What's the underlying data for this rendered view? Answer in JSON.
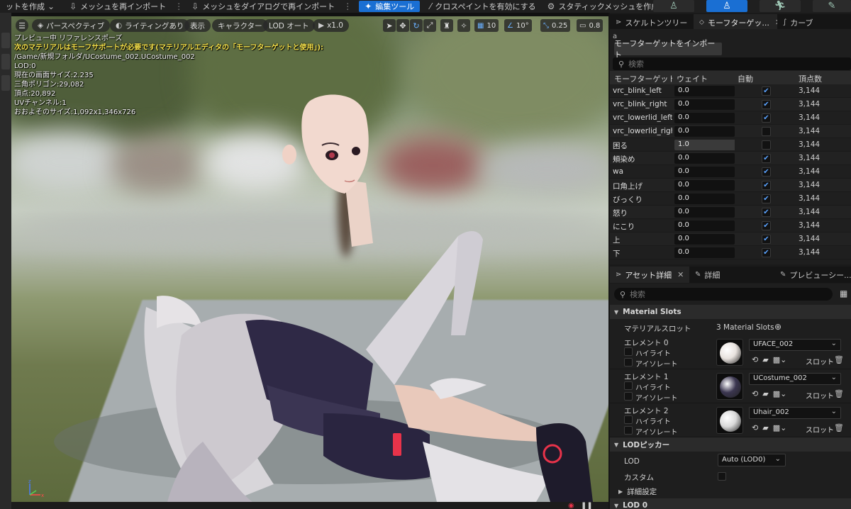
{
  "toolbar": {
    "create_label": "ットを作成",
    "reimport_label": "メッシュを再インポート",
    "reimport_dialog_label": "メッシュをダイアログで再インポート",
    "edit_tool_label": "編集ツール",
    "cloth_paint_label": "クロスペイントを有効にする",
    "static_mesh_label": "スタティックメッシュを作成"
  },
  "viewport": {
    "perspective_label": "パースペクティブ",
    "lighting_label": "ライティングあり",
    "show_label": "表示",
    "character_label": "キャラクター",
    "lod_label": "LOD オート",
    "play_label": "x1.0",
    "grid_value": "10",
    "angle_value": "10°",
    "scale_value": "0.25",
    "camera_speed_value": "0.8",
    "overlay": {
      "line1": "プレビュー中 リファレンスポーズ",
      "warning": "次のマテリアルはモーフサポートが必要です(マテリアルエディタの「モーフターゲットと使用」):",
      "path": "/Game/新規フォルダ/UCostume_002.UCostume_002",
      "lod": "LOD:0",
      "screen_size": "現在の画面サイズ:2.235",
      "triangles": "三角ポリゴン:29,082",
      "vertices": "頂点:20,892",
      "uv_channels": "UVチャンネル:1",
      "approx_size": "おおよそのサイズ:1,092x1,346x726"
    }
  },
  "panel_tabs": {
    "skeleton_tree": "スケルトンツリー",
    "morph_target": "モーフターゲッ...",
    "curve": "カーブ"
  },
  "morph": {
    "label_a": "a",
    "import_button": "モーフターゲットをインポート",
    "search_placeholder": "検索",
    "headers": {
      "name": "モーフターゲット名",
      "weight": "ウェイト",
      "auto": "自動",
      "vertex_count": "頂点数"
    },
    "rows": [
      {
        "name": "vrc_blink_left",
        "weight": "0.0",
        "auto": true,
        "vertices": "3,144"
      },
      {
        "name": "vrc_blink_right",
        "weight": "0.0",
        "auto": true,
        "vertices": "3,144"
      },
      {
        "name": "vrc_lowerlid_left",
        "weight": "0.0",
        "auto": true,
        "vertices": "3,144"
      },
      {
        "name": "vrc_lowerlid_right",
        "weight": "0.0",
        "auto": false,
        "vertices": "3,144"
      },
      {
        "name": "困る",
        "weight": "1.0",
        "auto": false,
        "vertices": "3,144"
      },
      {
        "name": "頬染め",
        "weight": "0.0",
        "auto": true,
        "vertices": "3,144"
      },
      {
        "name": "wa",
        "weight": "0.0",
        "auto": true,
        "vertices": "3,144"
      },
      {
        "name": "口角上げ",
        "weight": "0.0",
        "auto": true,
        "vertices": "3,144"
      },
      {
        "name": "びっくり",
        "weight": "0.0",
        "auto": true,
        "vertices": "3,144"
      },
      {
        "name": "怒り",
        "weight": "0.0",
        "auto": true,
        "vertices": "3,144"
      },
      {
        "name": "にこり",
        "weight": "0.0",
        "auto": true,
        "vertices": "3,144"
      },
      {
        "name": "上",
        "weight": "0.0",
        "auto": true,
        "vertices": "3,144"
      },
      {
        "name": "下",
        "weight": "0.0",
        "auto": true,
        "vertices": "3,144"
      }
    ]
  },
  "details_tabs": {
    "asset_details": "アセット詳細",
    "details": "詳細",
    "preview_scene": "プレビューシー..."
  },
  "details": {
    "search_placeholder": "検索",
    "material_slots_section": "Material Slots",
    "material_slot_label": "マテリアルスロット",
    "material_slot_count": "3 Material Slots",
    "highlight_label": "ハイライト",
    "isolate_label": "アイソレート",
    "slot_label": "スロット",
    "elements": [
      {
        "label": "エレメント 0",
        "material": "UFACE_002",
        "ball_color": "#e8e2de"
      },
      {
        "label": "エレメント 1",
        "material": "UCostume_002",
        "ball_color": "#3b3650"
      },
      {
        "label": "エレメント 2",
        "material": "Uhair_002",
        "ball_color": "#d9d9d9"
      }
    ],
    "lod_picker_section": "LODピッカー",
    "lod_label": "LOD",
    "lod_value": "Auto (LOD0)",
    "custom_label": "カスタム",
    "advanced_label": "詳細設定",
    "lod0_section": "LOD 0"
  },
  "colors": {
    "accent": "#1a6fd3",
    "warning_text": "#f5e14a",
    "checkbox_blue": "#5aa3ff"
  }
}
